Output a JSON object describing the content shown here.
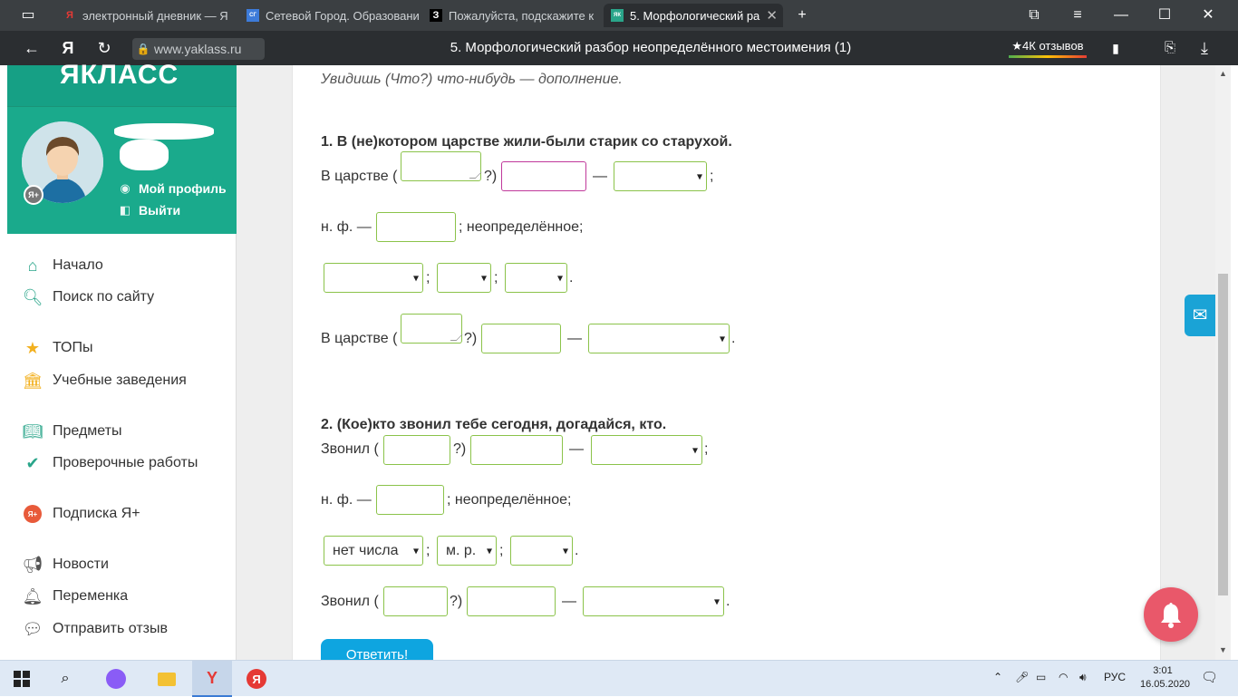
{
  "browser": {
    "tabs": [
      {
        "label": "электронный дневник — Я",
        "favicon": "Я"
      },
      {
        "label": "Сетевой Город. Образовани",
        "favicon": "СГ"
      },
      {
        "label": "Пожалуйста, подскажите к",
        "favicon": "З"
      },
      {
        "label": "5. Морфологический ра",
        "favicon": "ЯК"
      }
    ],
    "url": "www.yaklass.ru",
    "page_title": "5. Морфологический разбор неопределённого местоимения (1)",
    "reviews": "★4К отзывов"
  },
  "sidebar": {
    "logo": "ЯКЛАСС",
    "profile_link": "Мой профиль",
    "logout_link": "Выйти",
    "items": [
      {
        "label": "Начало",
        "icon": "home-icon"
      },
      {
        "label": "Поиск по сайту",
        "icon": "search-icon"
      },
      {
        "label": "ТОПы",
        "icon": "star-icon"
      },
      {
        "label": "Учебные заведения",
        "icon": "institution-icon"
      },
      {
        "label": "Предметы",
        "icon": "book-icon"
      },
      {
        "label": "Проверочные работы",
        "icon": "check-circle-icon"
      },
      {
        "label": "Подписка Я+",
        "icon": "plus-badge-icon"
      },
      {
        "label": "Новости",
        "icon": "megaphone-icon"
      },
      {
        "label": "Переменка",
        "icon": "bell-icon"
      },
      {
        "label": "Отправить отзыв",
        "icon": "chat-icon"
      }
    ]
  },
  "exercise": {
    "intro": "Увидишь (Что?) что-нибудь — дополнение.",
    "task1": {
      "sentence": "1. В (не)котором царстве жили-были старик со старухой.",
      "row1_prefix": "В царстве (",
      "row1_q": "?)",
      "dash": "—",
      "semicolon": ";",
      "nf_prefix": "н. ф. —",
      "nf_suffix": "; неопределённое;",
      "sep": ";",
      "dot": ".",
      "row4_prefix": "В царстве (",
      "row4_q": "?)"
    },
    "task2": {
      "sentence": "2. (Кое)кто звонил тебе сегодня, догадайся, кто.",
      "row1_prefix": "Звонил (",
      "row1_q": "?)",
      "dash": "—",
      "semicolon": ";",
      "nf_prefix": "н. ф. —",
      "nf_suffix": "; неопределённое;",
      "number_value": "нет числа",
      "gender_value": "м. р.",
      "sep": ";",
      "dot": ".",
      "row4_prefix": "Звонил (",
      "row4_q": "?)"
    },
    "submit_label": "Ответить!"
  },
  "taskbar": {
    "lang": "РУС",
    "time": "3:01",
    "date": "16.05.2020"
  },
  "colors": {
    "brand": "#1aaa8c",
    "field_border": "#8bc34a",
    "focus_border": "#c0399b",
    "submit": "#0ea5e0"
  }
}
